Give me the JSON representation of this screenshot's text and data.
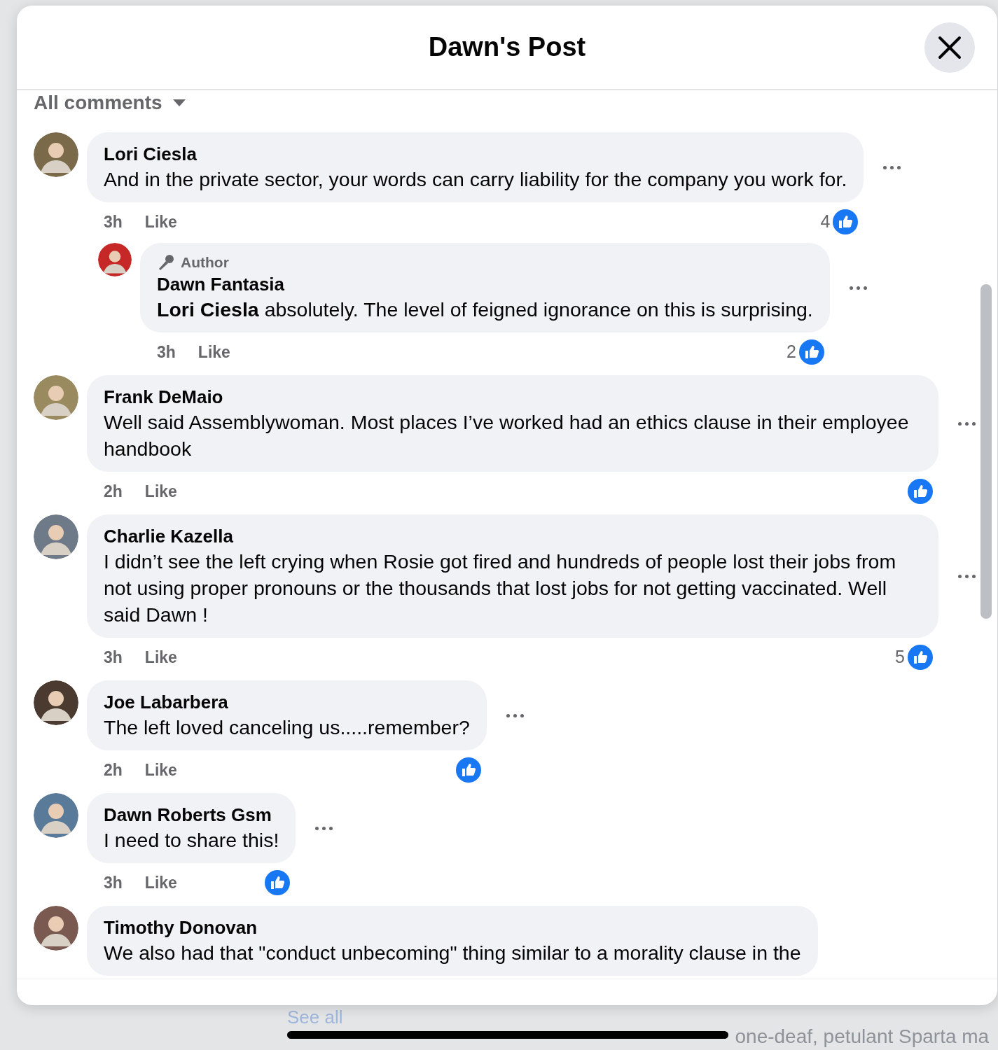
{
  "background_page": {
    "link": "See all",
    "snippet": "one-deaf, petulant Sparta ma"
  },
  "dialog": {
    "title": "Dawn's Post"
  },
  "sort": {
    "label": "All comments"
  },
  "comments": [
    {
      "author": "Lori Ciesla",
      "text": "And in the private sector, your words can carry liability for the company you work for.",
      "time": "3h",
      "action": "Like",
      "reaction_count": "4",
      "replies": [
        {
          "badge": "Author",
          "author": "Dawn Fantasia",
          "text": "**Lori Ciesla** absolutely. The level of feigned ignorance on this is surprising.",
          "time": "3h",
          "action": "Like",
          "reaction_count": "2"
        }
      ]
    },
    {
      "author": "Frank DeMaio",
      "text": "Well said Assemblywoman. Most places I’ve worked had an ethics clause in their employee handbook",
      "time": "2h",
      "action": "Like"
    },
    {
      "author": "Charlie Kazella",
      "text": "I didn’t see the left crying when Rosie got fired and hundreds of people lost their jobs from not using proper pronouns or the thousands that lost jobs for not getting vaccinated. Well said Dawn !",
      "time": "3h",
      "action": "Like",
      "reaction_count": "5"
    },
    {
      "author": "Joe Labarbera",
      "text": "The left loved canceling us.....remember?",
      "time": "2h",
      "action": "Like"
    },
    {
      "author": "Dawn Roberts Gsm",
      "text": "I need to share this!",
      "time": "3h",
      "action": "Like"
    },
    {
      "author": "Timothy Donovan",
      "text": "We also had that \"conduct unbecoming\" thing similar to a morality clause in the"
    }
  ]
}
